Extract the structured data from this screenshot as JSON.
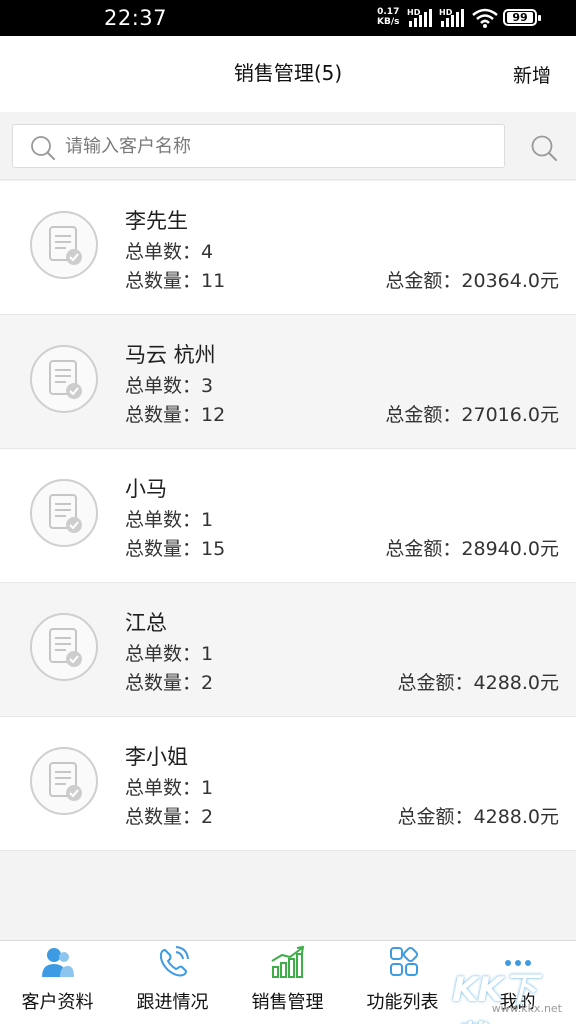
{
  "status_bar": {
    "time": "22:37",
    "speed_value": "0.17",
    "speed_unit": "KB/s",
    "hd1": "HD",
    "hd2": "HD",
    "battery": "99"
  },
  "header": {
    "title": "销售管理(5)",
    "add_label": "新增"
  },
  "search": {
    "placeholder": "请输入客户名称",
    "value": ""
  },
  "customers": [
    {
      "name": "李先生",
      "orders_label": "总单数：",
      "orders": "4",
      "qty_label": "总数量：",
      "qty": "11",
      "amount_label": "总金额：",
      "amount": "20364.0元"
    },
    {
      "name": "马云 杭州",
      "orders_label": "总单数：",
      "orders": "3",
      "qty_label": "总数量：",
      "qty": "12",
      "amount_label": "总金额：",
      "amount": "27016.0元"
    },
    {
      "name": "小马",
      "orders_label": "总单数：",
      "orders": "1",
      "qty_label": "总数量：",
      "qty": "15",
      "amount_label": "总金额：",
      "amount": "28940.0元"
    },
    {
      "name": "江总",
      "orders_label": "总单数：",
      "orders": "1",
      "qty_label": "总数量：",
      "qty": "2",
      "amount_label": "总金额：",
      "amount": "4288.0元"
    },
    {
      "name": "李小姐",
      "orders_label": "总单数：",
      "orders": "1",
      "qty_label": "总数量：",
      "qty": "2",
      "amount_label": "总金额：",
      "amount": "4288.0元"
    }
  ],
  "tabs": [
    {
      "label": "客户资料",
      "icon": "customers-icon"
    },
    {
      "label": "跟进情况",
      "icon": "phone-icon"
    },
    {
      "label": "销售管理",
      "icon": "sales-chart-icon",
      "active": true
    },
    {
      "label": "功能列表",
      "icon": "grid-icon"
    },
    {
      "label": "我的",
      "icon": "more-dots-icon"
    }
  ],
  "colors": {
    "accent_blue": "#3d9be3",
    "accent_green": "#3fae49"
  },
  "watermark": {
    "logo": "KK下载",
    "url": "www.kkx.net"
  }
}
